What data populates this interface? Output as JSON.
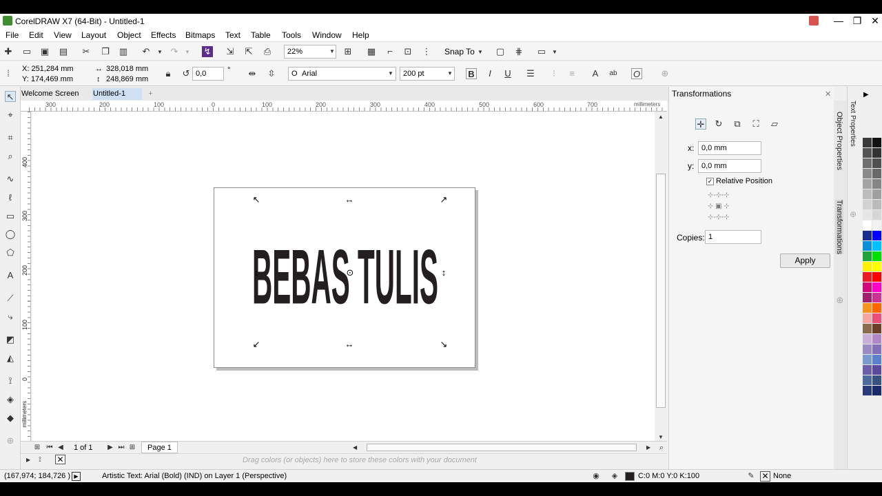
{
  "window": {
    "title": "CorelDRAW X7 (64-Bit) - Untitled-1",
    "min_glyph": "—",
    "max_glyph": "❐",
    "close_glyph": "✕"
  },
  "menu": [
    "File",
    "Edit",
    "View",
    "Layout",
    "Object",
    "Effects",
    "Bitmaps",
    "Text",
    "Table",
    "Tools",
    "Window",
    "Help"
  ],
  "standard_toolbar": {
    "zoom_value": "22%",
    "snap_label": "Snap To"
  },
  "property_bar": {
    "x_pos": "X: 251,284 mm",
    "y_pos": "Y: 174,469 mm",
    "width": "328,018 mm",
    "height": "248,869 mm",
    "rotation": "0,0",
    "degree_symbol": "°",
    "font_name": "Arial",
    "font_size": "200 pt"
  },
  "doc_tabs": {
    "welcome": "Welcome Screen",
    "current": "Untitled-1",
    "add": "+"
  },
  "rulers": {
    "unit": "millimeters",
    "h_ticks": [
      "300",
      "200",
      "100",
      "0",
      "100",
      "200",
      "300",
      "400",
      "500",
      "600",
      "700"
    ],
    "v_ticks": [
      "400",
      "300",
      "200",
      "100",
      "0"
    ]
  },
  "canvas": {
    "artwork_text": "BEBAS TULIS"
  },
  "page_nav": {
    "counter": "1 of 1",
    "page_tab": "Page 1"
  },
  "doc_palette_hint": "Drag colors (or objects) here to store these colors with your document",
  "docker": {
    "title": "Transformations",
    "x_label": "x:",
    "x_value": "0,0 mm",
    "y_label": "y:",
    "y_value": "0,0 mm",
    "relative_position": "Relative Position",
    "copies_label": "Copies:",
    "copies_value": "1",
    "apply": "Apply",
    "side_tabs": [
      "Object Properties",
      "Transformations"
    ],
    "palette_tab": "Text Properties"
  },
  "status": {
    "cursor": "(167,974; 184,726 )",
    "info": "Artistic Text: Arial (Bold) (IND) on Layer 1  (Perspective)",
    "fill": "C:0 M:0 Y:0 K:100",
    "outline": "None"
  },
  "palette_colors": [
    [
      "#3a3a3a",
      "#111111"
    ],
    [
      "#555555",
      "#333333"
    ],
    [
      "#6f6f6f",
      "#505050"
    ],
    [
      "#8a8a8a",
      "#6a6a6a"
    ],
    [
      "#a4a4a4",
      "#858585"
    ],
    [
      "#bcbcbc",
      "#a0a0a0"
    ],
    [
      "#d2d2d2",
      "#bbbbbb"
    ],
    [
      "#e6e6e6",
      "#d6d6d6"
    ],
    [
      "#ffffff",
      "#f2f2f2"
    ],
    [
      "#1b2c8f",
      "#0000ff"
    ],
    [
      "#0a8fd8",
      "#00c0ff"
    ],
    [
      "#1da43a",
      "#00e000"
    ],
    [
      "#fff200",
      "#ffff00"
    ],
    [
      "#ec1c24",
      "#ff0000"
    ],
    [
      "#d0087a",
      "#ff00c8"
    ],
    [
      "#a0206e",
      "#cc3399"
    ],
    [
      "#f7941d",
      "#ff6600"
    ],
    [
      "#f6a6a0",
      "#e8507a"
    ],
    [
      "#8c6c50",
      "#6b3f2a"
    ],
    [
      "#c6b0d8",
      "#b088c8"
    ],
    [
      "#9a8cc2",
      "#8470b8"
    ],
    [
      "#7b9ad0",
      "#5b82c8"
    ],
    [
      "#6a5fa8",
      "#5a4a9c"
    ],
    [
      "#4d6a9a",
      "#3a5280"
    ],
    [
      "#2a3a7a",
      "#1a2a6a"
    ]
  ],
  "accent_fill": "#231f20"
}
